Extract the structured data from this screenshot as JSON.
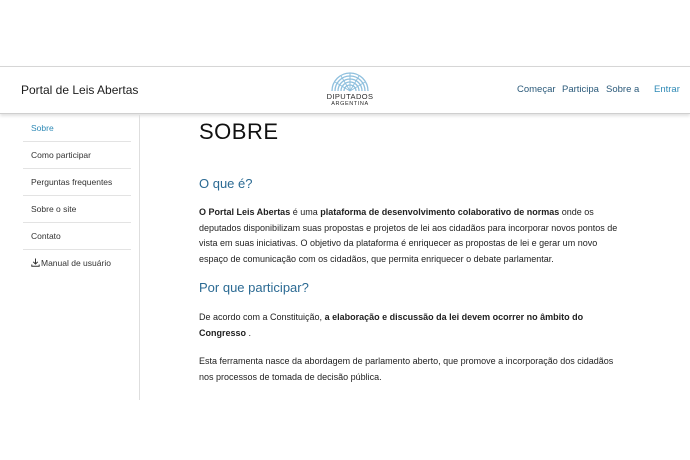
{
  "header": {
    "site_title": "Portal de Leis Abertas",
    "logo": {
      "name": "DIPUTADOS",
      "country": "ARGENTINA"
    },
    "nav": [
      "Começar",
      "Participa",
      "Sobre a",
      "Entrar"
    ]
  },
  "sidebar": {
    "items": [
      {
        "label": "Sobre",
        "active": true
      },
      {
        "label": "Como participar"
      },
      {
        "label": "Perguntas frequentes"
      },
      {
        "label": "Sobre o site"
      },
      {
        "label": "Contato"
      },
      {
        "label": "Manual de usuário",
        "icon": "download-icon"
      }
    ]
  },
  "main": {
    "title": "SOBRE",
    "section1_heading": "O que é?",
    "p1": {
      "b1": "O Portal Leis Abertas",
      "t1": " é uma ",
      "b2": "plataforma de desenvolvimento colaborativo de normas",
      "t2": " onde os deputados disponibilizam suas propostas e projetos de lei aos cidadãos para incorporar novos pontos de vista em suas iniciativas. O objetivo da plataforma é enriquecer as propostas de lei e gerar um novo espaço de comunicação com os cidadãos, que permita enriquecer o debate parlamentar."
    },
    "section2_heading": "Por que participar?",
    "p2": {
      "t1": "De acordo com a Constituição, ",
      "b1": "a elaboração e discussão da lei devem ocorrer no âmbito do Congresso",
      "t2": " ."
    },
    "p3": "Esta ferramenta nasce da abordagem de parlamento aberto, que promove a incorporação dos cidadãos nos processos de tomada de decisão pública."
  },
  "colors": {
    "accent": "#2f8ab6",
    "heading": "#2b6a93",
    "logo": "#8fc0de"
  }
}
